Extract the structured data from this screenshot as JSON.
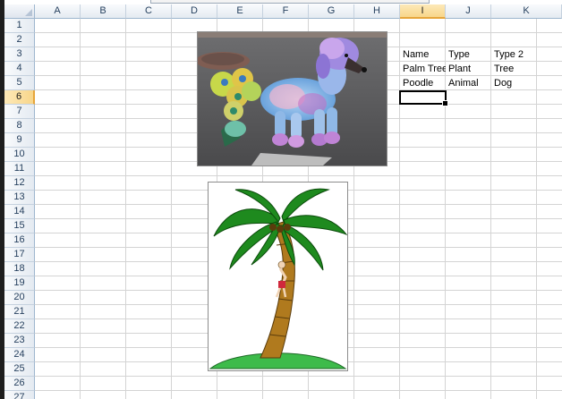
{
  "columns": [
    "A",
    "B",
    "C",
    "D",
    "E",
    "F",
    "G",
    "H",
    "I",
    "J",
    "K"
  ],
  "selected_column": "I",
  "rows": [
    "1",
    "2",
    "3",
    "4",
    "5",
    "6",
    "7",
    "8",
    "9",
    "10",
    "11",
    "12",
    "13",
    "14",
    "15",
    "16",
    "17",
    "18",
    "19",
    "20",
    "21",
    "22",
    "23",
    "24",
    "25",
    "26",
    "27"
  ],
  "selected_row": "6",
  "cells": {
    "I3": "Name",
    "J3": "Type",
    "K3": "Type 2",
    "I4": "Palm Tree",
    "J4": "Plant",
    "K4": "Tree",
    "I5": "Poodle",
    "J5": "Animal",
    "K5": "Dog"
  },
  "active_cell": "I6",
  "colors": {
    "header_bg": "#e4eaf1",
    "selected_header": "#f8d68a",
    "gridline": "#d4d4d4",
    "palm_leaf": "#1e8a1e",
    "trunk": "#b07a1e",
    "island": "#3dbb4a"
  },
  "images": [
    {
      "name": "poodle-photo",
      "subject": "groomed poodle dyed blue, purple and yellow"
    },
    {
      "name": "palm-tree-clipart",
      "subject": "palm tree on island with climbing figure"
    }
  ]
}
